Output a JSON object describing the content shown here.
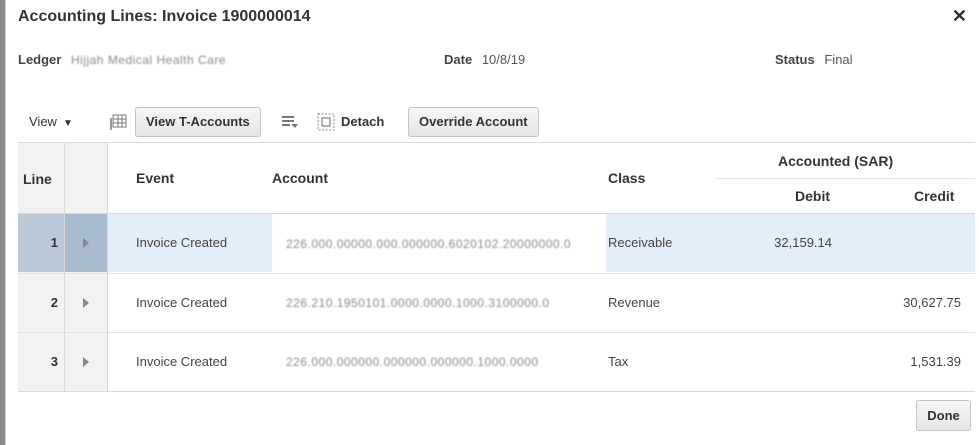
{
  "dialog": {
    "title": "Accounting Lines: Invoice 1900000014",
    "close_symbol": "✕"
  },
  "header": {
    "ledger_label": "Ledger",
    "ledger_value": "Hijjah Medical Health Care",
    "date_label": "Date",
    "date_value": "10/8/19",
    "status_label": "Status",
    "status_value": "Final"
  },
  "toolbar": {
    "view_label": "View",
    "view_t_accounts_label": "View T-Accounts",
    "detach_label": "Detach",
    "override_account_label": "Override Account"
  },
  "table": {
    "columns": {
      "line": "Line",
      "event": "Event",
      "account": "Account",
      "class": "Class",
      "accounted_group": "Accounted (SAR)",
      "debit": "Debit",
      "credit": "Credit"
    },
    "rows": [
      {
        "line": "1",
        "event": "Invoice Created",
        "account": "226.000.00000.000.000000.6020102.20000000.0",
        "class": "Receivable",
        "debit": "32,159.14",
        "credit": "",
        "selected": true
      },
      {
        "line": "2",
        "event": "Invoice Created",
        "account": "226.210.1950101.0000.0000.1000.3100000.0",
        "class": "Revenue",
        "debit": "",
        "credit": "30,627.75",
        "selected": false
      },
      {
        "line": "3",
        "event": "Invoice Created",
        "account": "226.000.000000.000000.000000.1000.0000",
        "class": "Tax",
        "debit": "",
        "credit": "1,531.39",
        "selected": false
      }
    ]
  },
  "footer": {
    "done_label": "Done"
  },
  "colors": {
    "selected_row": "#e3eefb",
    "selected_row_header": "#b9c9d8"
  }
}
